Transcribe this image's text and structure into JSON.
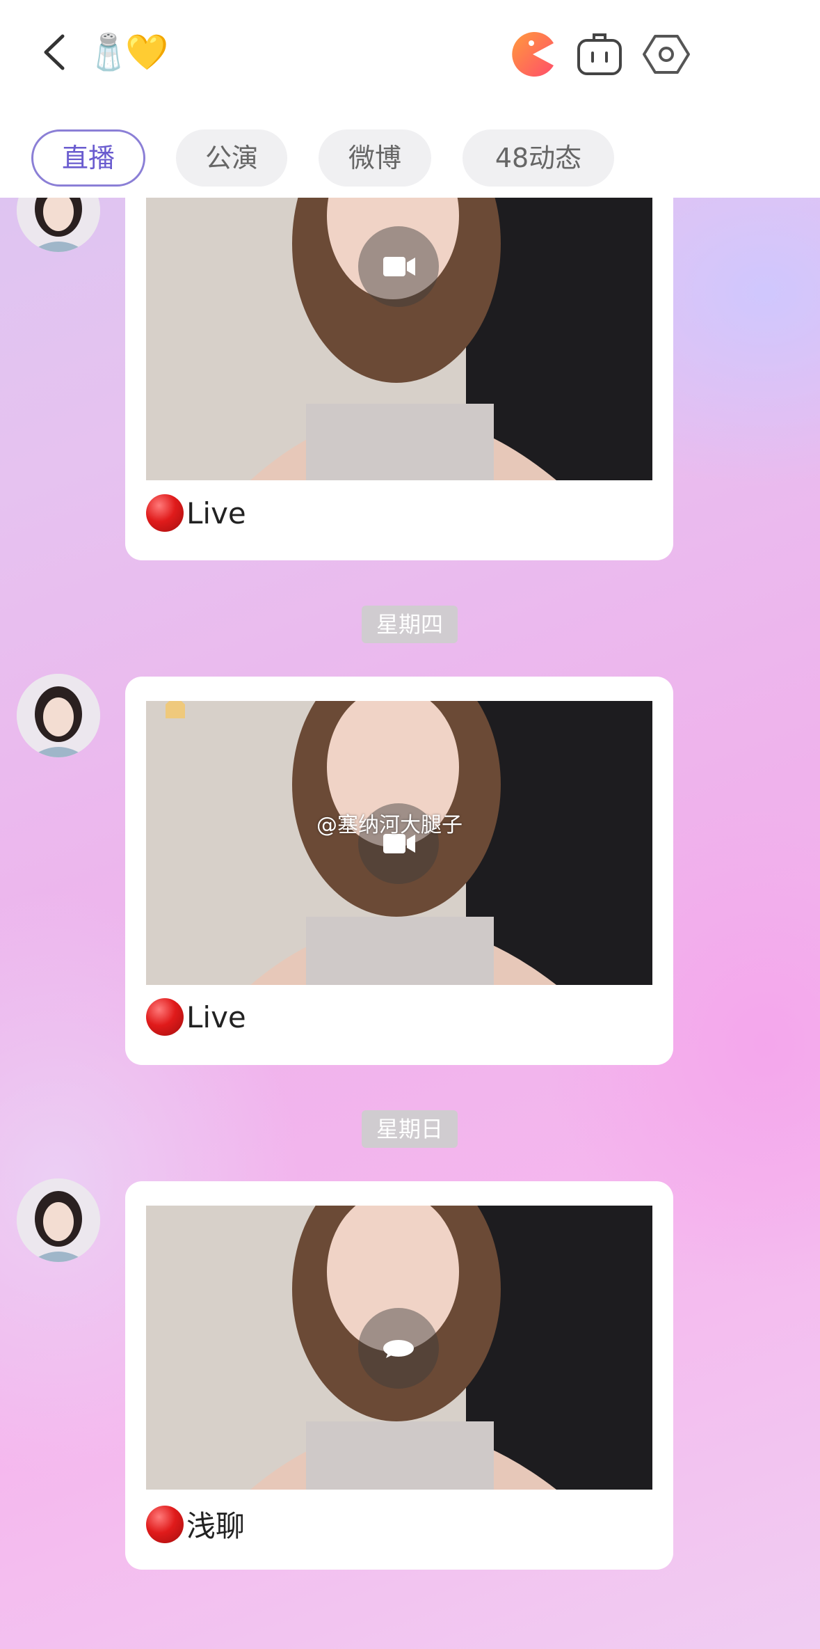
{
  "header": {
    "back": "back-icon",
    "emojis": [
      "🧂",
      "💛"
    ],
    "icons": [
      "pacman-icon",
      "robot-icon",
      "settings-hex-icon"
    ],
    "tabs": [
      {
        "label": "直播",
        "active": true
      },
      {
        "label": "公演",
        "active": false
      },
      {
        "label": "微博",
        "active": false
      },
      {
        "label": "48动态",
        "active": false
      }
    ]
  },
  "feed": {
    "posts": [
      {
        "label": "Live",
        "status_icon": "red-circle",
        "overlay": "video-camera-icon"
      },
      {
        "day": "星期四",
        "label": "Live",
        "status_icon": "red-circle",
        "overlay": "video-camera-icon"
      },
      {
        "day": "星期日",
        "label": "浅聊",
        "status_icon": "red-circle",
        "overlay": "chat-bubble-icon"
      }
    ]
  },
  "watermark": "@塞纳河大腿子",
  "colors": {
    "accent": "#6a5ccf",
    "live_red": "#e01b1b"
  }
}
